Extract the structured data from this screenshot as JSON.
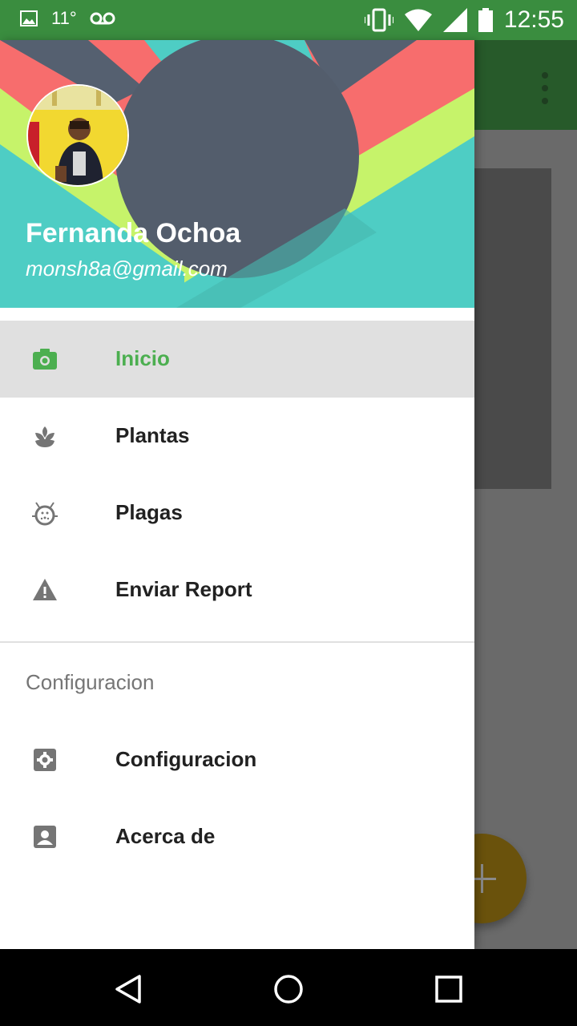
{
  "status_bar": {
    "temperature": "11°",
    "time": "12:55",
    "icons": [
      "image-icon",
      "voicemail-icon",
      "vibrate-icon",
      "wifi-icon",
      "signal-icon",
      "battery-icon"
    ]
  },
  "drawer": {
    "user": {
      "name": "Fernanda Ochoa",
      "email": "monsh8a@gmail.com"
    },
    "items": [
      {
        "label": "Inicio",
        "icon": "camera-icon",
        "active": true
      },
      {
        "label": "Plantas",
        "icon": "plant-icon",
        "active": false
      },
      {
        "label": "Plagas",
        "icon": "bug-icon",
        "active": false
      },
      {
        "label": "Enviar Report",
        "icon": "warning-icon",
        "active": false
      }
    ],
    "section_title": "Configuracion",
    "section_items": [
      {
        "label": "Configuracion",
        "icon": "settings-icon"
      },
      {
        "label": "Acerca de",
        "icon": "contact-icon"
      }
    ]
  },
  "colors": {
    "accent": "#4caf50",
    "status_bar": "#3a8d3f",
    "header_teal": "#4ecdc4"
  },
  "nav_bar": {
    "buttons": [
      "back-icon",
      "home-icon",
      "recents-icon"
    ]
  }
}
